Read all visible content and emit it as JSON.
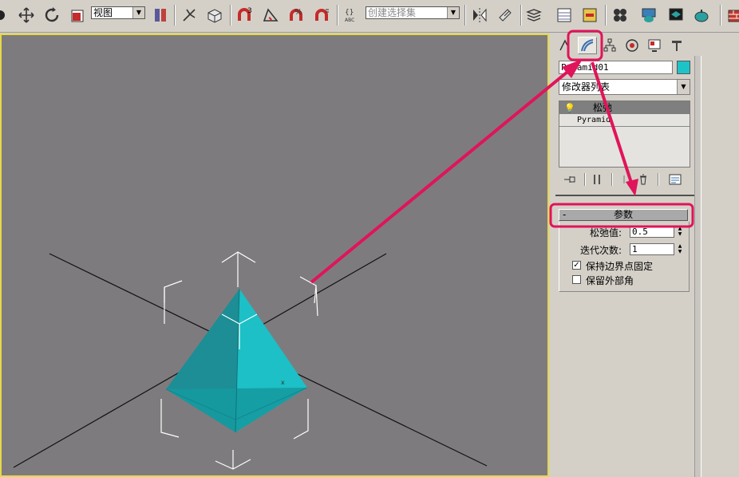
{
  "toolbar": {
    "viewport_combo": "视图",
    "selection_set_placeholder": "创建选择集",
    "snap_angle_label": "3",
    "icons": [
      "select-icon",
      "move-icon",
      "rotate-icon",
      "scale-icon",
      "mirror-icon",
      "align-icon",
      "layer-icon",
      "curve-editor-icon",
      "schematic-icon",
      "material-editor-icon",
      "render-setup-icon",
      "render-icon",
      "quick-render-icon"
    ]
  },
  "command_panel": {
    "tabs": [
      "create-tab",
      "modify-tab",
      "hierarchy-tab",
      "motion-tab",
      "display-tab",
      "utilities-tab"
    ],
    "object_name": "Pyramid01",
    "object_color": "#1cc4c8",
    "modifier_list": "修改器列表",
    "stack": {
      "modifier": "松弛",
      "base_object": "Pyramid"
    },
    "rollout": {
      "toggle": "-",
      "title": "参数",
      "relax_value_label": "松弛值:",
      "relax_value": "0.5",
      "iterations_label": "迭代次数:",
      "iterations": "1",
      "keep_boundary_label": "保持边界点固定",
      "keep_boundary_checked": "✓",
      "save_outer_corners_label": "保留外部角"
    }
  },
  "viewport": {
    "background": "#7e7b7e",
    "object_color": "#1cc4c8"
  },
  "annotation_color": "#e0145a"
}
